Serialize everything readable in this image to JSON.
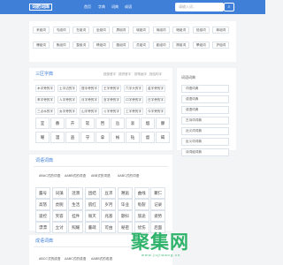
{
  "header": {
    "logo": "词肥词库",
    "nav": [
      "首页",
      "字典",
      "词典",
      "成语"
    ],
    "search_placeholder": "请输入词...",
    "search_icon": "search-icon"
  },
  "top_tags": [
    "来组词",
    "丐组词",
    "在组词",
    "坐组词",
    "屏组词",
    "城组词",
    "商组词",
    "暗组词",
    "炫组词",
    "邮组词",
    "爆组词",
    "焦组词",
    "整组词",
    "晴组词",
    "腹组词",
    "灵组词",
    "影组词",
    "擦组词",
    "攀组词",
    "护组词"
  ],
  "main": {
    "title": "三区字典",
    "tabs": [
      "按部首字",
      "按拼音字",
      "按笔画字",
      "按结构字"
    ],
    "row1": [
      "木字旁的字",
      "土字边的字",
      "提手旁的字",
      "王字旁的字",
      "穴字头的字",
      "金字旁的字"
    ],
    "row2": [
      "禾字旁的字",
      "人字旁的字",
      "月字旁的字",
      "言字旁的字",
      "口字旁的字",
      "日字旁的字"
    ],
    "row3": [
      "三点水的字",
      "女字旁的字",
      "山字旁的字",
      "ㄍ字旁的字",
      "工字旁的字",
      "今字旁的字"
    ],
    "chars1": [
      "宜",
      "番",
      "卉",
      "软",
      "笆",
      "岳",
      "衷",
      "烟",
      "腺"
    ],
    "chars2": [
      "曜",
      "漫",
      "盗",
      "守",
      "拿",
      "帐",
      "钻",
      "督",
      "碣"
    ]
  },
  "words": {
    "title": "词语词典",
    "sub": [
      "ABAC式的词语",
      "AABB式的词语",
      "ABB式的词语",
      "AABC式的词语"
    ],
    "grid": [
      [
        "露号",
        "词藻",
        "涟漪",
        "团结",
        "豆沛",
        "邂逅",
        "曲线",
        "聚仁"
      ],
      [
        "高怒",
        "虎睨",
        "生活",
        "肌红",
        "岁月",
        "毕业",
        "龟裂",
        "记录"
      ],
      [
        "遥控",
        "笑容",
        "挂件",
        "毁灭",
        "兆基",
        "颤抖",
        "旅途",
        "姿势"
      ],
      [
        "漂漂",
        "立讨",
        "照耀",
        "董疏",
        "可由",
        "秘密",
        "忧伤",
        "后面"
      ]
    ]
  },
  "idioms": {
    "title": "成语词典",
    "sub": [
      "ABCC式的成语",
      "AABC式的成语",
      "AABB式的成语"
    ]
  },
  "sidebar": {
    "title": "词语词典",
    "items": [
      "词语词典",
      "成语词典",
      "成语词典",
      "古诗词词典",
      "近义词词典",
      "反义词词典",
      "诗词组词典"
    ]
  },
  "watermark": {
    "text": "聚集网",
    "sub": "www.jujiwang.cn"
  }
}
